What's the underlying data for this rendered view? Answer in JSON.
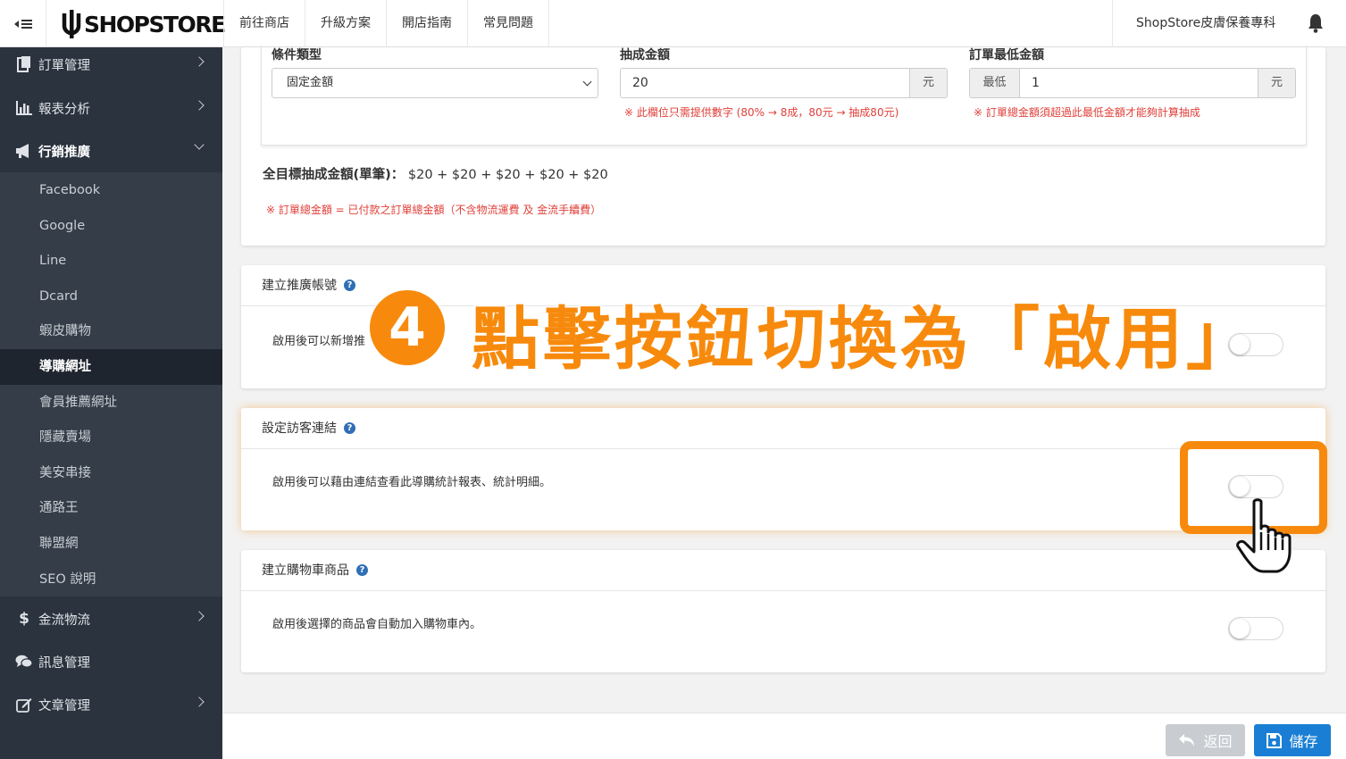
{
  "topbar": {
    "logo_text": "SHOPSTORE",
    "nav": [
      "前往商店",
      "升級方案",
      "開店指南",
      "常見問題"
    ],
    "store_name": "ShopStore皮膚保養專科"
  },
  "sidebar": {
    "items": [
      {
        "label": "訂單管理",
        "icon": "clipboard-icon"
      },
      {
        "label": "報表分析",
        "icon": "bar-chart-icon"
      },
      {
        "label": "行銷推廣",
        "icon": "megaphone-icon"
      },
      {
        "label": "金流物流",
        "icon": "dollar-icon"
      },
      {
        "label": "訊息管理",
        "icon": "chat-icon"
      },
      {
        "label": "文章管理",
        "icon": "edit-icon"
      }
    ],
    "submenu": [
      "Facebook",
      "Google",
      "Line",
      "Dcard",
      "蝦皮購物",
      "導購網址",
      "會員推薦網址",
      "隱藏賣場",
      "美安串接",
      "通路王",
      "聯盟網",
      "SEO 說明"
    ],
    "active_submenu": "導購網址"
  },
  "commission": {
    "condition_label": "條件類型",
    "condition_value": "固定金額",
    "amount_label": "抽成金額",
    "amount_value": "20",
    "amount_unit": "元",
    "amount_hint": "※ 此欄位只需提供數字 (80% → 8成，80元 → 抽成80元)",
    "min_label": "訂單最低金額",
    "min_prefix": "最低",
    "min_value": "1",
    "min_unit": "元",
    "min_hint": "※ 訂單總金額須超過此最低金額才能夠計算抽成",
    "formula_label": "全目標抽成金額(單筆)：",
    "formula_value": "$20 + $20 + $20 + $20 + $20",
    "total_note": "※ 訂單總金額 = 已付款之訂單總金額（不含物流運費 及 金流手續費）"
  },
  "panels": [
    {
      "title": "建立推廣帳號",
      "desc": "啟用後可以新增推",
      "enabled": false
    },
    {
      "title": "設定訪客連結",
      "desc": "啟用後可以藉由連結查看此導購統計報表、統計明細。",
      "enabled": false
    },
    {
      "title": "建立購物車商品",
      "desc": "啟用後選擇的商品會自動加入購物車內。",
      "enabled": false
    }
  ],
  "footer": {
    "back_label": "返回",
    "save_label": "儲存"
  },
  "annotation": {
    "step_number": "4",
    "text": "點擊按鈕切換為「啟用」",
    "accent_color": "#f78a0c"
  }
}
